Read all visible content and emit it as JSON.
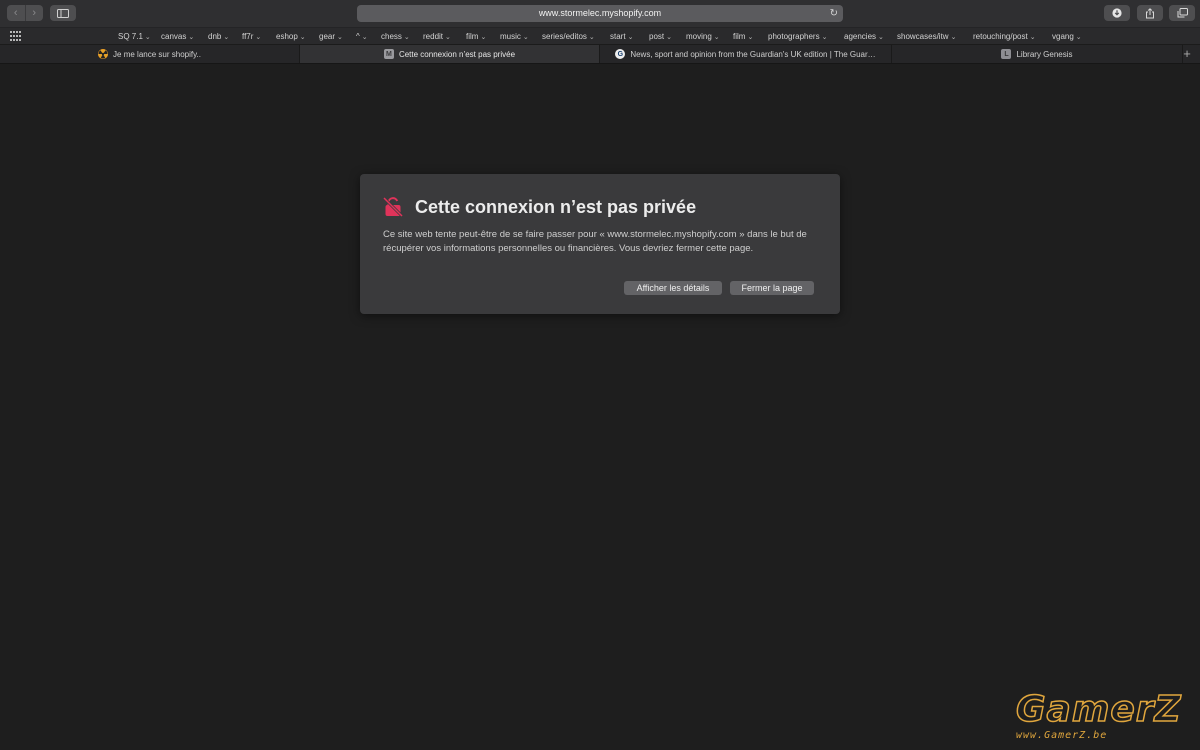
{
  "toolbar": {
    "url": "www.stormelec.myshopify.com",
    "icons": {
      "back": "chevron-left-icon",
      "forward": "chevron-right-icon",
      "sidebar": "sidebar-icon",
      "reload": "reload-icon",
      "downloads": "download-icon",
      "share": "share-icon",
      "tabs": "tabs-overview-icon"
    }
  },
  "bookmarks": {
    "items": [
      {
        "label": "SQ 7.1"
      },
      {
        "label": "canvas"
      },
      {
        "label": "dnb"
      },
      {
        "label": "ff7r"
      },
      {
        "label": "eshop"
      },
      {
        "label": "gear"
      },
      {
        "label": "^"
      },
      {
        "label": "chess"
      },
      {
        "label": "reddit"
      },
      {
        "label": "film"
      },
      {
        "label": "music"
      },
      {
        "label": "series/editos"
      },
      {
        "label": "start"
      },
      {
        "label": "post"
      },
      {
        "label": "moving"
      },
      {
        "label": "film"
      },
      {
        "label": "photographers"
      },
      {
        "label": "agencies"
      },
      {
        "label": "showcases/itw"
      },
      {
        "label": "retouching/post"
      },
      {
        "label": "vgang"
      }
    ]
  },
  "tabs": [
    {
      "title": "Je me lance sur shopify..",
      "favicon": "",
      "active": false
    },
    {
      "title": "Cette connexion n’est pas privée",
      "favicon": "M",
      "active": true
    },
    {
      "title": "News, sport and opinion from the Guardian's UK edition | The Guar…",
      "favicon": "G",
      "active": false
    },
    {
      "title": "Library Genesis",
      "favicon": "L",
      "active": false
    }
  ],
  "dialog": {
    "title": "Cette connexion n’est pas privée",
    "body": "Ce site web tente peut-être de se faire passer pour « www.stormelec.myshopify.com » dans le but de récupérer vos informations personnelles ou financières. Vous devriez fermer cette page.",
    "details_button": "Afficher les détails",
    "close_button": "Fermer la page",
    "icon_color": "#e0335a"
  },
  "watermark": {
    "logo": "GamerZ",
    "url": "www.GamerZ.be",
    "color": "#e0a63d"
  }
}
